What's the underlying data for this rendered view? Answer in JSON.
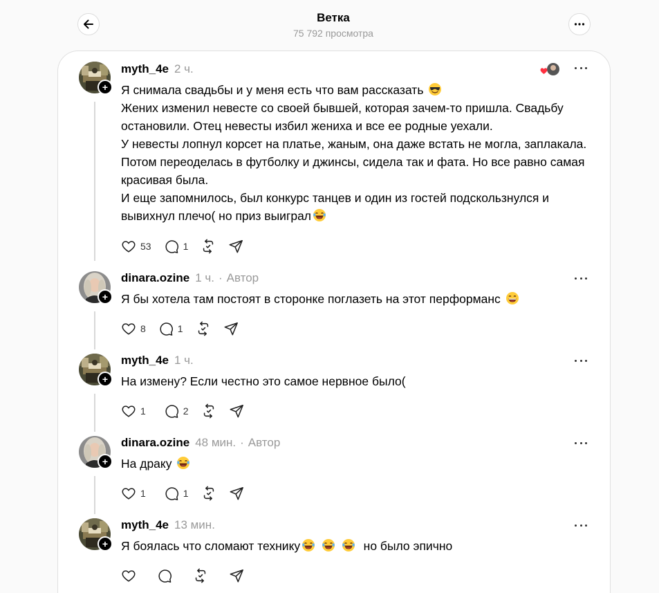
{
  "header": {
    "title": "Ветка",
    "views": "75 792 просмотра",
    "back_icon": "arrow-left-icon",
    "more_icon": "more-horizontal-icon"
  },
  "colors": {
    "like_heart": "#ff3040",
    "muted_text": "#999999",
    "thread_line": "#d8d8d8"
  },
  "posts": [
    {
      "username": "myth_4e",
      "time": "2 ч.",
      "author": "",
      "lines": [
        "Я снимала свадьбы и у меня есть что вам рассказать",
        "Жених изменил невесте со своей бывшей, которая зачем-то пришла. Свадьбу остановили. Отец невесты избил жениха и все ее родные уехали.",
        "У невесты лопнул корсет на платье, жаным, она даже встать не могла, заплакала. Потом переоделась в футболку и джинсы, сидела так и фата. Но все равно самая красивая была.",
        "И еще запомнилось, был конкурс танцев и один из гостей подскользнулся и вывихнул плечо( но приз выиграл"
      ],
      "likes": "53",
      "comments": "1",
      "reposts": "",
      "emojis": [
        "sunglasses-emoji",
        "laughing-emoji"
      ]
    },
    {
      "username": "dinara.ozine",
      "time": "1 ч.",
      "author": "Автор",
      "text": "Я бы хотела там постоят в сторонке поглазеть на этот перформанс",
      "likes": "8",
      "comments": "1",
      "emojis": [
        "grinning-emoji"
      ]
    },
    {
      "username": "myth_4e",
      "time": "1 ч.",
      "author": "",
      "text": "На измену? Если честно это самое нервное было(",
      "likes": "1",
      "comments": "2"
    },
    {
      "username": "dinara.ozine",
      "time": "48 мин.",
      "author": "Автор",
      "text": "На драку",
      "likes": "1",
      "comments": "1",
      "emojis": [
        "laughing-emoji"
      ]
    },
    {
      "username": "myth_4e",
      "time": "13 мин.",
      "author": "",
      "text_before": "Я боялась что сломают технику",
      "text_after": "но было эпично",
      "likes": "",
      "comments": "",
      "emojis": [
        "laughing-emoji",
        "laughing-emoji",
        "laughing-emoji"
      ]
    }
  ],
  "dot_separator": "·",
  "follow_symbol": "+"
}
